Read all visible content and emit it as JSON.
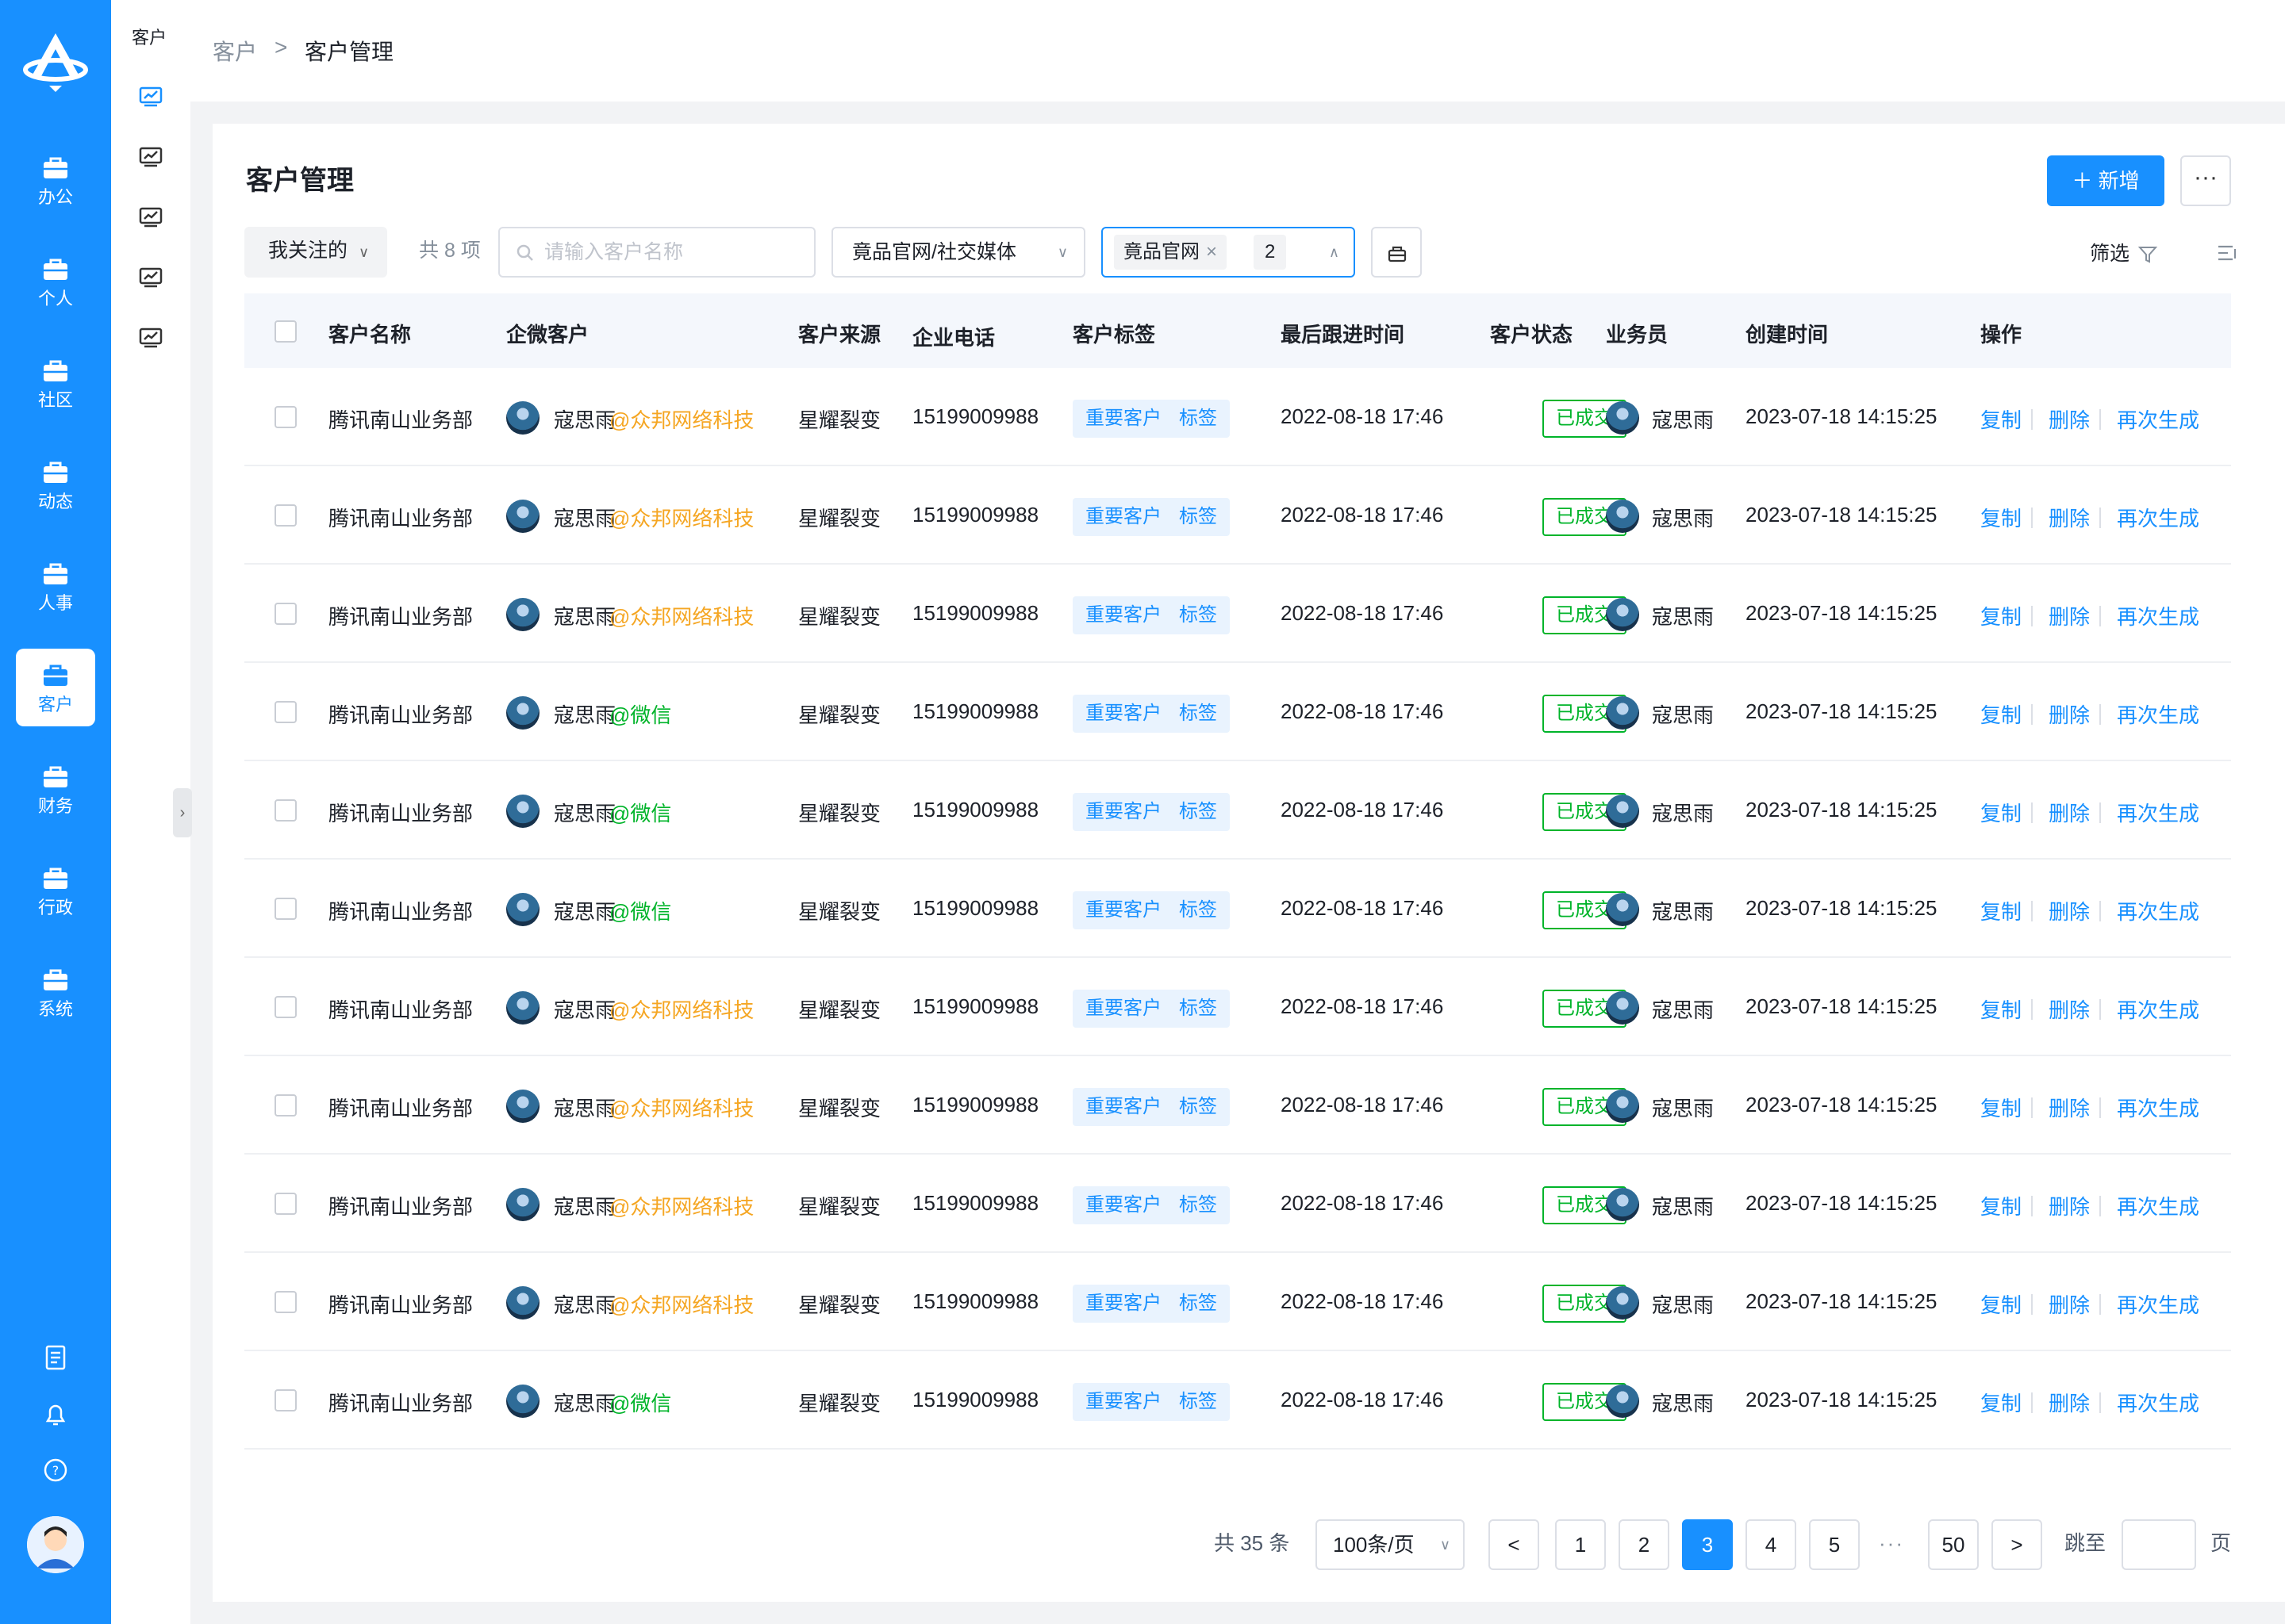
{
  "sidebar": {
    "items": [
      {
        "label": "办公",
        "icon": "briefcase-icon"
      },
      {
        "label": "个人",
        "icon": "briefcase-icon"
      },
      {
        "label": "社区",
        "icon": "briefcase-icon"
      },
      {
        "label": "动态",
        "icon": "briefcase-icon"
      },
      {
        "label": "人事",
        "icon": "briefcase-icon"
      },
      {
        "label": "客户",
        "icon": "briefcase-icon",
        "active": true
      },
      {
        "label": "财务",
        "icon": "briefcase-icon"
      },
      {
        "label": "行政",
        "icon": "briefcase-icon"
      },
      {
        "label": "系统",
        "icon": "briefcase-icon"
      }
    ],
    "tools": [
      "document-icon",
      "bell-icon",
      "help-icon"
    ]
  },
  "subnav": {
    "title": "客户"
  },
  "breadcrumb": {
    "parent": "客户",
    "current": "客户管理"
  },
  "page": {
    "title": "客户管理",
    "new_label": "新增",
    "more_label": "···"
  },
  "toolbar": {
    "focus_filter": "我关注的",
    "count": "共 8 项",
    "search_placeholder": "请输入客户名称",
    "source_filter": "竟品官网/社交媒体",
    "selected_tag": "竟品官网",
    "selected_more": "2",
    "filter_label": "筛选"
  },
  "table": {
    "headers": {
      "name": "客户名称",
      "wecom": "企微客户",
      "source": "客户来源",
      "phone": "企业电话",
      "tags": "客户标签",
      "last_follow": "最后跟进时间",
      "status": "客户状态",
      "sales": "业务员",
      "created": "创建时间",
      "actions": "操作"
    },
    "rows": [
      {
        "name": "腾讯南山业务部",
        "wecom_name": "寇思雨",
        "wecom_org": "@众邦网络科技",
        "org_type": "corp",
        "source": "星耀裂变",
        "phone": "15199009988",
        "tag1": "重要客户",
        "tag2": "标签",
        "last_follow": "2022-08-18 17:46",
        "status": "已成交",
        "sales": "寇思雨",
        "created": "2023-07-18 14:15:25",
        "act_copy": "复制",
        "act_delete": "删除",
        "act_regen": "再次生成"
      },
      {
        "name": "腾讯南山业务部",
        "wecom_name": "寇思雨",
        "wecom_org": "@众邦网络科技",
        "org_type": "corp",
        "source": "星耀裂变",
        "phone": "15199009988",
        "tag1": "重要客户",
        "tag2": "标签",
        "last_follow": "2022-08-18 17:46",
        "status": "已成交",
        "sales": "寇思雨",
        "created": "2023-07-18 14:15:25",
        "act_copy": "复制",
        "act_delete": "删除",
        "act_regen": "再次生成"
      },
      {
        "name": "腾讯南山业务部",
        "wecom_name": "寇思雨",
        "wecom_org": "@众邦网络科技",
        "org_type": "corp",
        "source": "星耀裂变",
        "phone": "15199009988",
        "tag1": "重要客户",
        "tag2": "标签",
        "last_follow": "2022-08-18 17:46",
        "status": "已成交",
        "sales": "寇思雨",
        "created": "2023-07-18 14:15:25",
        "act_copy": "复制",
        "act_delete": "删除",
        "act_regen": "再次生成"
      },
      {
        "name": "腾讯南山业务部",
        "wecom_name": "寇思雨",
        "wecom_org": "@微信",
        "org_type": "wechat",
        "source": "星耀裂变",
        "phone": "15199009988",
        "tag1": "重要客户",
        "tag2": "标签",
        "last_follow": "2022-08-18 17:46",
        "status": "已成交",
        "sales": "寇思雨",
        "created": "2023-07-18 14:15:25",
        "act_copy": "复制",
        "act_delete": "删除",
        "act_regen": "再次生成"
      },
      {
        "name": "腾讯南山业务部",
        "wecom_name": "寇思雨",
        "wecom_org": "@微信",
        "org_type": "wechat",
        "source": "星耀裂变",
        "phone": "15199009988",
        "tag1": "重要客户",
        "tag2": "标签",
        "last_follow": "2022-08-18 17:46",
        "status": "已成交",
        "sales": "寇思雨",
        "created": "2023-07-18 14:15:25",
        "act_copy": "复制",
        "act_delete": "删除",
        "act_regen": "再次生成"
      },
      {
        "name": "腾讯南山业务部",
        "wecom_name": "寇思雨",
        "wecom_org": "@微信",
        "org_type": "wechat",
        "source": "星耀裂变",
        "phone": "15199009988",
        "tag1": "重要客户",
        "tag2": "标签",
        "last_follow": "2022-08-18 17:46",
        "status": "已成交",
        "sales": "寇思雨",
        "created": "2023-07-18 14:15:25",
        "act_copy": "复制",
        "act_delete": "删除",
        "act_regen": "再次生成"
      },
      {
        "name": "腾讯南山业务部",
        "wecom_name": "寇思雨",
        "wecom_org": "@众邦网络科技",
        "org_type": "corp",
        "source": "星耀裂变",
        "phone": "15199009988",
        "tag1": "重要客户",
        "tag2": "标签",
        "last_follow": "2022-08-18 17:46",
        "status": "已成交",
        "sales": "寇思雨",
        "created": "2023-07-18 14:15:25",
        "act_copy": "复制",
        "act_delete": "删除",
        "act_regen": "再次生成"
      },
      {
        "name": "腾讯南山业务部",
        "wecom_name": "寇思雨",
        "wecom_org": "@众邦网络科技",
        "org_type": "corp",
        "source": "星耀裂变",
        "phone": "15199009988",
        "tag1": "重要客户",
        "tag2": "标签",
        "last_follow": "2022-08-18 17:46",
        "status": "已成交",
        "sales": "寇思雨",
        "created": "2023-07-18 14:15:25",
        "act_copy": "复制",
        "act_delete": "删除",
        "act_regen": "再次生成"
      },
      {
        "name": "腾讯南山业务部",
        "wecom_name": "寇思雨",
        "wecom_org": "@众邦网络科技",
        "org_type": "corp",
        "source": "星耀裂变",
        "phone": "15199009988",
        "tag1": "重要客户",
        "tag2": "标签",
        "last_follow": "2022-08-18 17:46",
        "status": "已成交",
        "sales": "寇思雨",
        "created": "2023-07-18 14:15:25",
        "act_copy": "复制",
        "act_delete": "删除",
        "act_regen": "再次生成"
      },
      {
        "name": "腾讯南山业务部",
        "wecom_name": "寇思雨",
        "wecom_org": "@众邦网络科技",
        "org_type": "corp",
        "source": "星耀裂变",
        "phone": "15199009988",
        "tag1": "重要客户",
        "tag2": "标签",
        "last_follow": "2022-08-18 17:46",
        "status": "已成交",
        "sales": "寇思雨",
        "created": "2023-07-18 14:15:25",
        "act_copy": "复制",
        "act_delete": "删除",
        "act_regen": "再次生成"
      },
      {
        "name": "腾讯南山业务部",
        "wecom_name": "寇思雨",
        "wecom_org": "@微信",
        "org_type": "wechat",
        "source": "星耀裂变",
        "phone": "15199009988",
        "tag1": "重要客户",
        "tag2": "标签",
        "last_follow": "2022-08-18 17:46",
        "status": "已成交",
        "sales": "寇思雨",
        "created": "2023-07-18 14:15:25",
        "act_copy": "复制",
        "act_delete": "删除",
        "act_regen": "再次生成"
      }
    ]
  },
  "pagination": {
    "total": "共 35 条",
    "page_size": "100条/页",
    "pages": [
      "1",
      "2",
      "3",
      "4",
      "5"
    ],
    "current": "3",
    "ellipsis": "···",
    "last": "50",
    "jump_label": "跳至",
    "page_suffix": "页"
  },
  "colors": {
    "primary": "#1890ff",
    "status_green": "#00b42a",
    "org_corp": "#f5a623",
    "org_wechat": "#00b42a"
  }
}
